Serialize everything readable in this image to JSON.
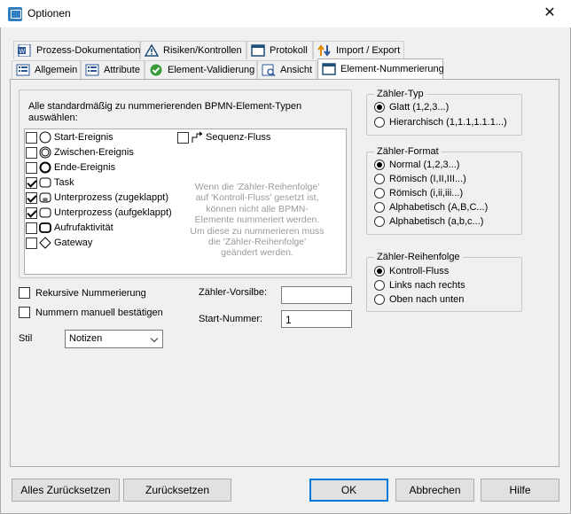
{
  "window": {
    "title": "Optionen",
    "close_glyph": "✕"
  },
  "tabs_row1": [
    {
      "label": "Prozess-Dokumentation",
      "icon": "word-doc-icon"
    },
    {
      "label": "Risiken/Kontrollen",
      "icon": "warning-triangle-icon"
    },
    {
      "label": "Protokoll",
      "icon": "window-icon"
    },
    {
      "label": "Import / Export",
      "icon": "import-export-icon"
    }
  ],
  "tabs_row2": [
    {
      "label": "Allgemein",
      "icon": "list-icon"
    },
    {
      "label": "Attribute",
      "icon": "list-icon"
    },
    {
      "label": "Element-Validierung",
      "icon": "green-check-icon"
    },
    {
      "label": "Ansicht",
      "icon": "view-icon"
    },
    {
      "label": "Element-Nummerierung",
      "icon": "window-icon",
      "active": true
    }
  ],
  "types_section": {
    "label": "Alle standardmäßig zu nummerierenden BPMN-Element-Typen auswählen:",
    "items": [
      {
        "label": "Start-Ereignis",
        "checked": false
      },
      {
        "label": "Zwischen-Ereignis",
        "checked": false
      },
      {
        "label": "Ende-Ereignis",
        "checked": false
      },
      {
        "label": "Task",
        "checked": true
      },
      {
        "label": "Unterprozess (zugeklappt)",
        "checked": true
      },
      {
        "label": "Unterprozess (aufgeklappt)",
        "checked": true
      },
      {
        "label": "Aufrufaktivität",
        "checked": false
      },
      {
        "label": "Gateway",
        "checked": false
      }
    ],
    "items_col2": [
      {
        "label": "Sequenz-Fluss",
        "checked": false
      }
    ],
    "hint": "Wenn die 'Zähler-Reihenfolge'\nauf 'Kontroll-Fluss' gesetzt ist,\nkönnen nicht alle BPMN-\nElemente nummeriert werden.\nUm diese zu nummerieren muss\ndie 'Zähler-Reihenfolge'\ngeändert werden."
  },
  "zaehler_typ": {
    "title": "Zähler-Typ",
    "options": [
      {
        "label": "Glatt (1,2,3...)",
        "selected": true
      },
      {
        "label": "Hierarchisch (1,1.1,1.1.1...)",
        "selected": false
      }
    ]
  },
  "zaehler_format": {
    "title": "Zähler-Format",
    "options": [
      {
        "label": "Normal (1,2,3...)",
        "selected": true
      },
      {
        "label": "Römisch (I,II,III...)",
        "selected": false
      },
      {
        "label": "Römisch (i,ii,iii...)",
        "selected": false
      },
      {
        "label": "Alphabetisch (A,B,C...)",
        "selected": false
      },
      {
        "label": "Alphabetisch (a,b,c...)",
        "selected": false
      }
    ]
  },
  "zaehler_reihenfolge": {
    "title": "Zähler-Reihenfolge",
    "options": [
      {
        "label": "Kontroll-Fluss",
        "selected": true
      },
      {
        "label": "Links nach rechts",
        "selected": false
      },
      {
        "label": "Oben nach unten",
        "selected": false
      }
    ]
  },
  "options": {
    "rekursiv": {
      "label": "Rekursive Nummerierung",
      "checked": false
    },
    "manuell": {
      "label": "Nummern manuell bestätigen",
      "checked": false
    }
  },
  "fields": {
    "vorsilbe_label": "Zähler-Vorsilbe:",
    "vorsilbe_value": "",
    "startnummer_label": "Start-Nummer:",
    "startnummer_value": "1",
    "stil_label": "Stil",
    "stil_value": "Notizen"
  },
  "buttons": {
    "reset_all": "Alles Zurücksetzen",
    "reset": "Zurücksetzen",
    "ok": "OK",
    "cancel": "Abbrechen",
    "help": "Hilfe"
  },
  "colors": {
    "accent": "#0078d7",
    "hint_text": "#9a9a9a",
    "tab_active_bg": "#ffffff"
  }
}
